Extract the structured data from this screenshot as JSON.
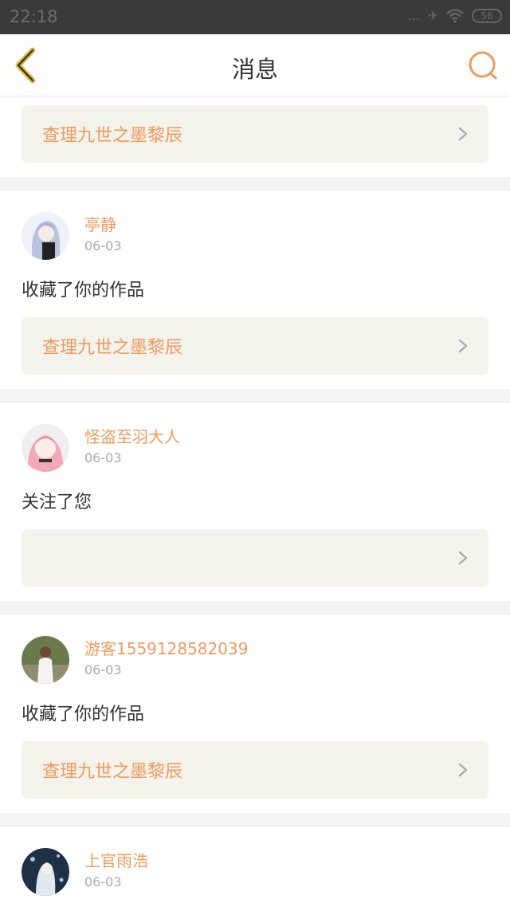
{
  "status_bar": {
    "time": "22:18",
    "dots": "...",
    "battery": "56"
  },
  "header": {
    "title": "消息"
  },
  "colors": {
    "accent": "#ef9a5e",
    "back_icon": "#e9b93a",
    "card_bg": "#f3f3ec"
  },
  "messages": [
    {
      "work": "查理九世之墨黎辰"
    },
    {
      "user": "亭静",
      "date": "06-03",
      "action": "收藏了你的作品",
      "work": "查理九世之墨黎辰"
    },
    {
      "user": "怪盗至羽大人",
      "date": "06-03",
      "action": "关注了您",
      "work": ""
    },
    {
      "user": "游客1559128582039",
      "date": "06-03",
      "action": "收藏了你的作品",
      "work": "查理九世之墨黎辰"
    },
    {
      "user": "上官雨浩",
      "date": "06-03"
    }
  ]
}
